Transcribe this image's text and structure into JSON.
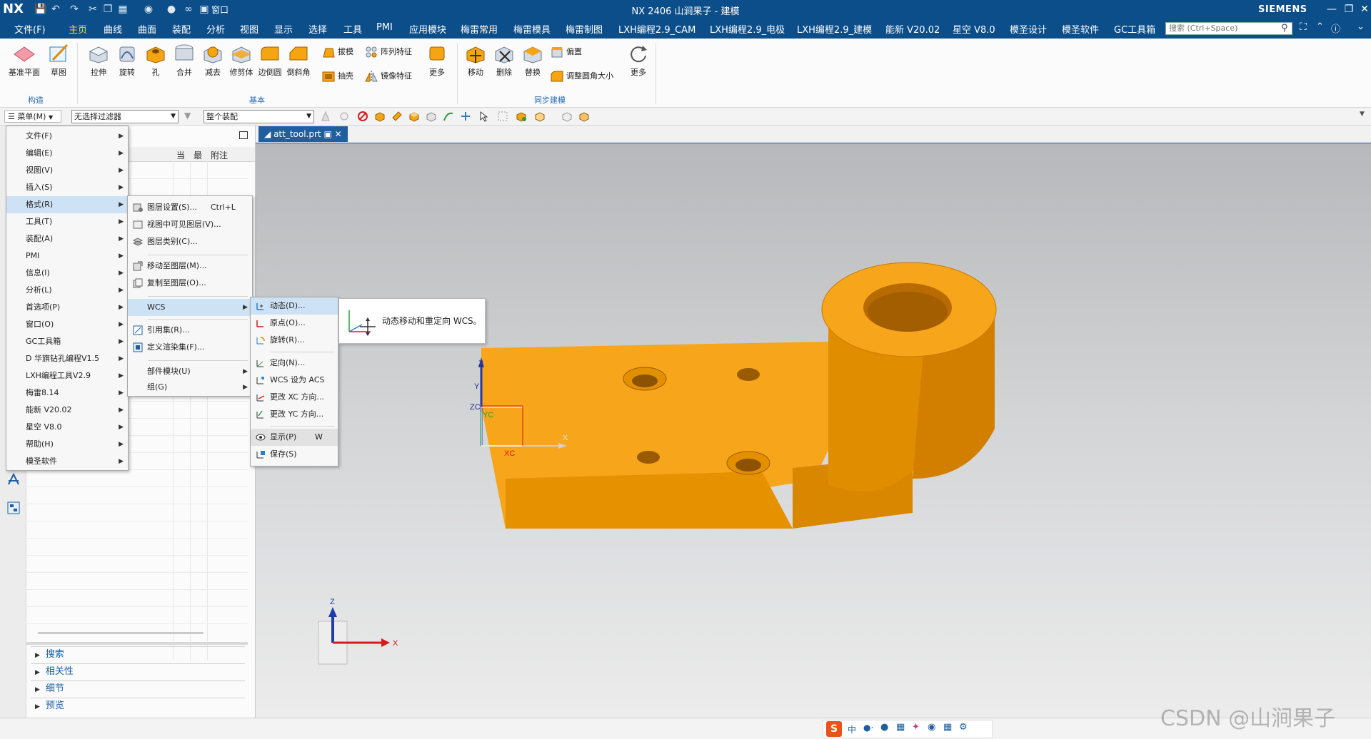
{
  "app": {
    "logo": "NX",
    "title": "NX 2406 山涧果子 - 建模",
    "brand": "SIEMENS",
    "window_menu": "窗口"
  },
  "tabs": [
    "文件(F)",
    "主页",
    "曲线",
    "曲面",
    "装配",
    "分析",
    "视图",
    "显示",
    "选择",
    "工具",
    "PMI",
    "应用模块",
    "梅雷常用",
    "梅雷模具",
    "梅雷制图",
    "LXH编程2.9_CAM",
    "LXH编程2.9_电极",
    "LXH编程2.9_建模",
    "能新 V20.02",
    "星空 V8.0",
    "模圣设计",
    "模圣软件",
    "GC工具箱"
  ],
  "active_tab": "主页",
  "search": {
    "placeholder": "搜索 (Ctrl+Space)"
  },
  "ribbon": {
    "construct": {
      "datum_plane": "基准平面",
      "sketch": "草图",
      "group_label": "构造"
    },
    "basic": {
      "extrude": "拉伸",
      "revolve": "旋转",
      "hole": "孔",
      "unite": "合并",
      "subtract": "减去",
      "trim_body": "修剪体",
      "edge_blend": "边倒圆",
      "chamfer": "倒斜角",
      "draft": "拔模",
      "shell": "抽壳",
      "pattern_feature": "阵列特征",
      "mirror_feature": "镜像特征",
      "more": "更多",
      "group_label": "基本"
    },
    "sync": {
      "move": "移动",
      "delete": "删除",
      "replace": "替换",
      "offset": "偏置",
      "resize_blend": "调整圆角大小",
      "more": "更多",
      "group_label": "同步建模"
    }
  },
  "toolbar": {
    "menu_button": "菜单(M)",
    "filter": "无选择过滤器",
    "scope": "整个装配"
  },
  "navigator": {
    "columns": [
      "当",
      "最",
      "附注"
    ],
    "sections": [
      "搜索",
      "相关性",
      "细节",
      "预览"
    ]
  },
  "doc_tab": "att_tool.prt",
  "main_menu": [
    "文件(F)",
    "编辑(E)",
    "视图(V)",
    "插入(S)",
    "格式(R)",
    "工具(T)",
    "装配(A)",
    "PMI",
    "信息(I)",
    "分析(L)",
    "首选项(P)",
    "窗口(O)",
    "GC工具箱",
    "D 华旗钻孔编程V1.5",
    "LXH编程工具V2.9",
    "梅雷8.14",
    "能新 V20.02",
    "星空 V8.0",
    "帮助(H)",
    "模圣软件"
  ],
  "format_menu": {
    "layer_settings": "图层设置(S)...",
    "layer_settings_shortcut": "Ctrl+L",
    "visible_layers": "视图中可见图层(V)...",
    "layer_category": "图层类别(C)...",
    "move_to_layer": "移动至图层(M)...",
    "copy_to_layer": "复制至图层(O)...",
    "wcs": "WCS",
    "reference_set": "引用集(R)...",
    "render_set": "定义渲染集(F)...",
    "part_module": "部件模块(U)",
    "group": "组(G)"
  },
  "wcs_menu": {
    "dynamic": "动态(D)...",
    "origin": "原点(O)...",
    "rotate": "旋转(R)...",
    "orient": "定向(N)...",
    "set_as_acs": "WCS 设为 ACS",
    "change_xc": "更改 XC 方向...",
    "change_yc": "更改 YC 方向...",
    "display": "显示(P)",
    "display_shortcut": "W",
    "save": "保存(S)"
  },
  "tooltip": "动态移动和重定向 WCS。",
  "axes": {
    "zc": "ZC",
    "yc": "YC",
    "xc": "XC",
    "x": "X",
    "y": "Y",
    "z": "Z"
  },
  "watermark": "CSDN @山涧果子",
  "ime": {
    "lang": "中"
  },
  "colors": {
    "titlebar": "#0c4e8a",
    "active_tab": "#ffd54a",
    "part": "#f5a412",
    "part_side": "#d98700",
    "highlight": "#cde3f5"
  }
}
